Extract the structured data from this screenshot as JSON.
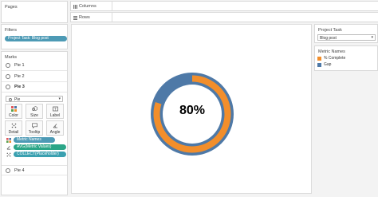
{
  "colors": {
    "complete": "#f28e2b",
    "gap": "#4e79a7",
    "pill_blue": "#4d9ab5",
    "pill_green": "#2aa587"
  },
  "pages": {
    "title": "Pages"
  },
  "filters": {
    "title": "Filters",
    "items": [
      "Project Task: Blog post"
    ]
  },
  "marks": {
    "title": "Marks",
    "pies": [
      "Pie 1",
      "Pie 2",
      "Pie 3"
    ],
    "mark_type": "Pie",
    "cards": [
      "Color",
      "Size",
      "Label",
      "Detail",
      "Tooltip",
      "Angle"
    ],
    "fields": [
      "Metric Names",
      "AVG(Metric Values)",
      "COLLECT(Placeholder)"
    ],
    "last_pie": "Pie 4"
  },
  "shelves": {
    "columns": "Columns",
    "rows": "Rows"
  },
  "view": {
    "label": "80%",
    "pct_complete": 0.8
  },
  "project_task": {
    "title": "Project Task",
    "value": "Blog post"
  },
  "legend": {
    "title": "Metric Names",
    "items": [
      {
        "label": "% Complete",
        "color": "#f28e2b"
      },
      {
        "label": "Gap",
        "color": "#4e79a7"
      }
    ]
  }
}
